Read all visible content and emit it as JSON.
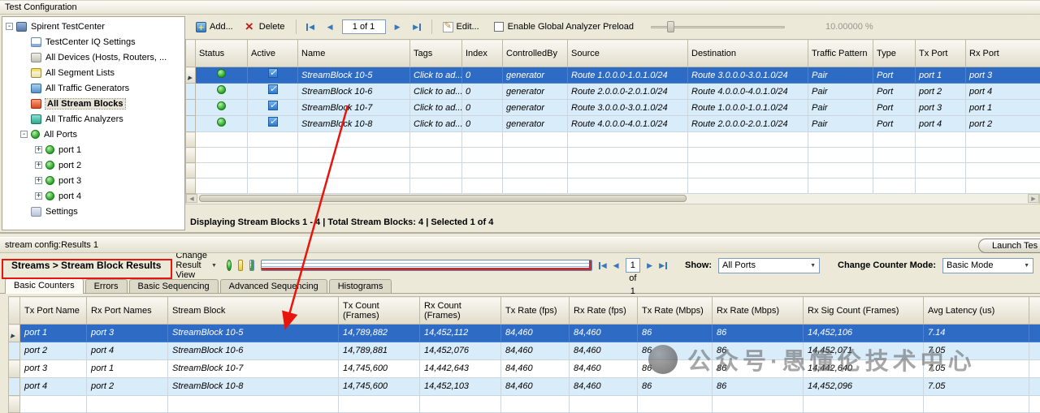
{
  "top": {
    "title": "Test Configuration",
    "tree": {
      "items": [
        {
          "label": "Spirent TestCenter"
        },
        {
          "label": "TestCenter IQ Settings"
        },
        {
          "label": "All Devices (Hosts, Routers, ..."
        },
        {
          "label": "All Segment Lists"
        },
        {
          "label": "All Traffic Generators"
        },
        {
          "label": "All Stream Blocks"
        },
        {
          "label": "All Traffic Analyzers"
        },
        {
          "label": "All Ports"
        },
        {
          "label": "port 1"
        },
        {
          "label": "port 2"
        },
        {
          "label": "port 3"
        },
        {
          "label": "port 4"
        },
        {
          "label": "Settings"
        }
      ]
    },
    "toolbar": {
      "add_label": "Add...",
      "delete_label": "Delete",
      "page": "1 of 1",
      "edit_label": "Edit...",
      "preload_label": "Enable Global Analyzer Preload",
      "percent": "10.00000 %"
    },
    "table": {
      "columns": [
        "Status",
        "Active",
        "Name",
        "Tags",
        "Index",
        "ControlledBy",
        "Source",
        "Destination",
        "Traffic Pattern",
        "Type",
        "Tx Port",
        "Rx Port"
      ],
      "rows": [
        [
          "StreamBlock 10-5",
          "Click to ad...",
          "0",
          "generator",
          "Route 1.0.0.0-1.0.1.0/24",
          "Route 3.0.0.0-3.0.1.0/24",
          "Pair",
          "Port",
          "port 1",
          "port 3"
        ],
        [
          "StreamBlock 10-6",
          "Click to ad...",
          "0",
          "generator",
          "Route 2.0.0.0-2.0.1.0/24",
          "Route 4.0.0.0-4.0.1.0/24",
          "Pair",
          "Port",
          "port 2",
          "port 4"
        ],
        [
          "StreamBlock 10-7",
          "Click to ad...",
          "0",
          "generator",
          "Route 3.0.0.0-3.0.1.0/24",
          "Route 1.0.0.0-1.0.1.0/24",
          "Pair",
          "Port",
          "port 3",
          "port 1"
        ],
        [
          "StreamBlock 10-8",
          "Click to ad...",
          "0",
          "generator",
          "Route 4.0.0.0-4.0.1.0/24",
          "Route 2.0.0.0-2.0.1.0/24",
          "Pair",
          "Port",
          "port 4",
          "port 2"
        ]
      ]
    },
    "status_bar": "Displaying Stream Blocks 1 - 4  |  Total Stream Blocks: 4  |  Selected 1 of 4"
  },
  "bottom": {
    "title": "stream config:Results 1",
    "launch_label": "Launch Tes",
    "toolbar": {
      "breadcrumb": "Streams > Stream Block Results",
      "change_view_label": "Change Result View",
      "page": "1 of 1",
      "show_label": "Show:",
      "show_value": "All Ports",
      "counter_mode_label": "Change Counter Mode:",
      "counter_mode_value": "Basic Mode"
    },
    "tabs": [
      "Basic Counters",
      "Errors",
      "Basic Sequencing",
      "Advanced Sequencing",
      "Histograms"
    ],
    "table": {
      "columns": [
        "Tx Port Name",
        "Rx Port Names",
        "Stream Block",
        "Tx Count (Frames)",
        "Rx Count (Frames)",
        "Tx Rate (fps)",
        "Rx Rate (fps)",
        "Tx Rate (Mbps)",
        "Rx Rate (Mbps)",
        "Rx Sig Count (Frames)",
        "Avg Latency (us)"
      ],
      "rows": [
        [
          "port 1",
          "port 3",
          "StreamBlock 10-5",
          "14,789,882",
          "14,452,112",
          "84,460",
          "84,460",
          "86",
          "86",
          "14,452,106",
          "7.14"
        ],
        [
          "port 2",
          "port 4",
          "StreamBlock 10-6",
          "14,789,881",
          "14,452,076",
          "84,460",
          "84,460",
          "86",
          "86",
          "14,452,071",
          "7.05"
        ],
        [
          "port 3",
          "port 1",
          "StreamBlock 10-7",
          "14,745,600",
          "14,442,643",
          "84,460",
          "84,460",
          "86",
          "86",
          "14,442,640",
          "7.05"
        ],
        [
          "port 4",
          "port 2",
          "StreamBlock 10-8",
          "14,745,600",
          "14,452,103",
          "84,460",
          "84,460",
          "86",
          "86",
          "14,452,096",
          "7.05"
        ]
      ]
    }
  },
  "watermark": {
    "text": "公众号·愚懂伦技术中心"
  },
  "annotation_color": "#e8150c"
}
